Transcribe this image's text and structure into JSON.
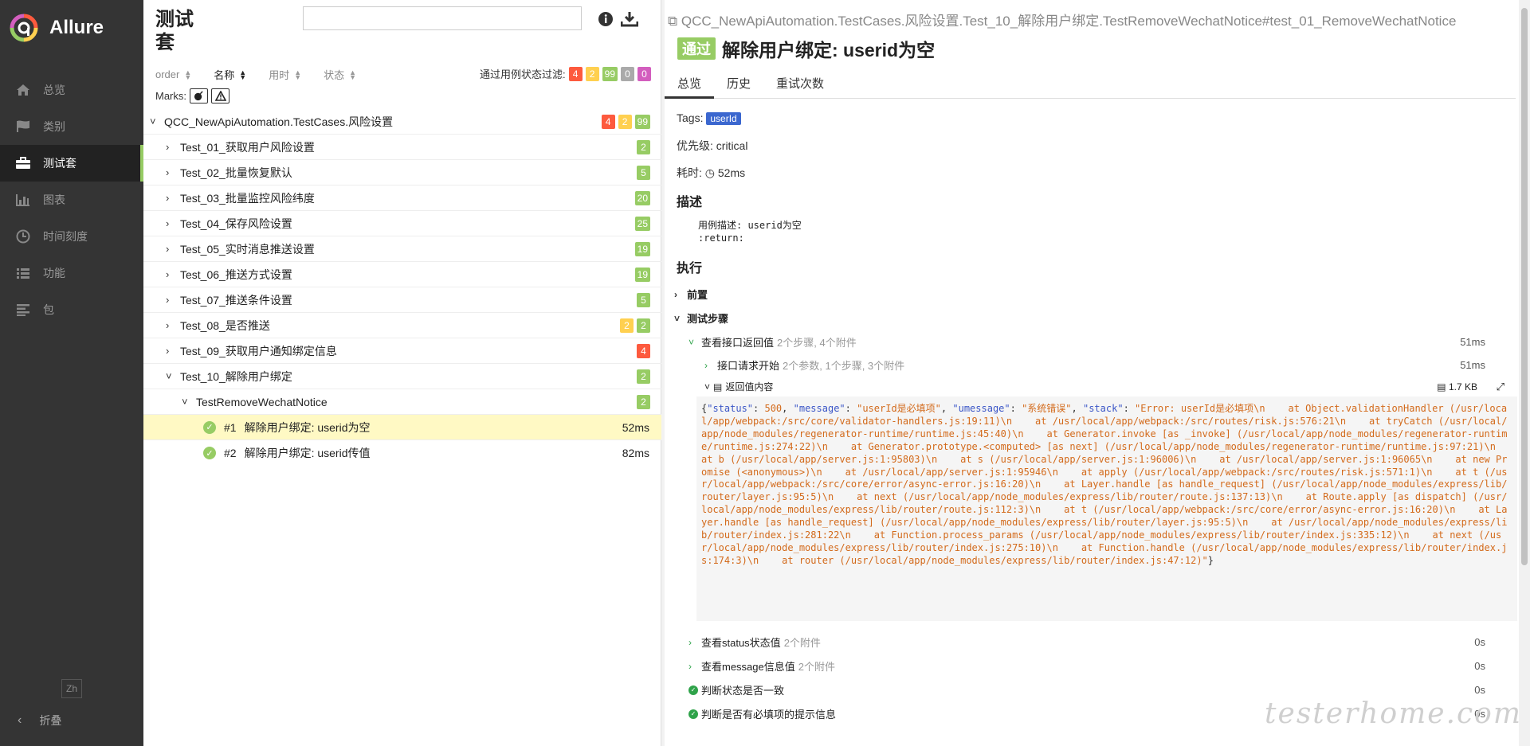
{
  "brand": {
    "name": "Allure"
  },
  "sidebar": {
    "items": [
      {
        "label": "总览",
        "icon": "home-icon"
      },
      {
        "label": "类别",
        "icon": "flag-icon"
      },
      {
        "label": "测试套",
        "icon": "briefcase-icon",
        "active": true
      },
      {
        "label": "图表",
        "icon": "bar-chart-icon"
      },
      {
        "label": "时间刻度",
        "icon": "clock-icon"
      },
      {
        "label": "功能",
        "icon": "list-icon"
      },
      {
        "label": "包",
        "icon": "align-left-icon"
      }
    ],
    "lang": "Zh",
    "collapse": "折叠"
  },
  "suites": {
    "title": "测试套",
    "search_placeholder": "",
    "sort": [
      "order",
      "名称",
      "用时",
      "状态"
    ],
    "filter_label": "通过用例状态过滤:",
    "filter_counts": {
      "failed": "4",
      "broken": "2",
      "passed": "99",
      "skipped": "0",
      "unknown": "0"
    },
    "marks_label": "Marks:",
    "root": {
      "name": "QCC_NewApiAutomation.TestCases.风险设置",
      "counts": [
        "4",
        "2",
        "99"
      ]
    },
    "groups": [
      {
        "name": "Test_01_获取用户风险设置",
        "counts": [
          {
            "v": "2",
            "c": "passed"
          }
        ]
      },
      {
        "name": "Test_02_批量恢复默认",
        "counts": [
          {
            "v": "5",
            "c": "passed"
          }
        ]
      },
      {
        "name": "Test_03_批量监控风险纬度",
        "counts": [
          {
            "v": "20",
            "c": "passed"
          }
        ]
      },
      {
        "name": "Test_04_保存风险设置",
        "counts": [
          {
            "v": "25",
            "c": "passed"
          }
        ]
      },
      {
        "name": "Test_05_实时消息推送设置",
        "counts": [
          {
            "v": "19",
            "c": "passed"
          }
        ]
      },
      {
        "name": "Test_06_推送方式设置",
        "counts": [
          {
            "v": "19",
            "c": "passed"
          }
        ]
      },
      {
        "name": "Test_07_推送条件设置",
        "counts": [
          {
            "v": "5",
            "c": "passed"
          }
        ]
      },
      {
        "name": "Test_08_是否推送",
        "counts": [
          {
            "v": "2",
            "c": "broken"
          },
          {
            "v": "2",
            "c": "passed"
          }
        ]
      },
      {
        "name": "Test_09_获取用户通知绑定信息",
        "counts": [
          {
            "v": "4",
            "c": "failed"
          }
        ]
      },
      {
        "name": "Test_10_解除用户绑定",
        "counts": [
          {
            "v": "2",
            "c": "passed"
          }
        ]
      }
    ],
    "class": {
      "name": "TestRemoveWechatNotice",
      "count": "2"
    },
    "tests": [
      {
        "num": "#1",
        "name": "解除用户绑定: userid为空",
        "dur": "52ms"
      },
      {
        "num": "#2",
        "name": "解除用户绑定: userid传值",
        "dur": "82ms"
      }
    ]
  },
  "detail": {
    "breadcrumb": "QCC_NewApiAutomation.TestCases.风险设置.Test_10_解除用户绑定.TestRemoveWechatNotice#test_01_RemoveWechatNotice",
    "status": "通过",
    "title": "解除用户绑定: userid为空",
    "tabs": [
      "总览",
      "历史",
      "重试次数"
    ],
    "tags_label": "Tags:",
    "tag": "userId",
    "severity_label": "优先级:",
    "severity": "critical",
    "duration_label": "耗时:",
    "duration": "52ms",
    "desc_title": "描述",
    "desc_line1": "用例描述: userid为空",
    "desc_line2": ":return:",
    "exec_title": "执行",
    "setup": "前置",
    "steps_title": "测试步骤",
    "steps": [
      {
        "name": "查看接口返回值",
        "meta": "2个步骤, 4个附件",
        "dur": "51ms"
      },
      {
        "name": "接口请求开始",
        "meta": "2个参数, 1个步骤, 3个附件",
        "dur": "51ms"
      },
      {
        "name": "查看status状态值",
        "meta": "2个附件",
        "dur": "0s"
      },
      {
        "name": "查看message信息值",
        "meta": "2个附件",
        "dur": "0s"
      },
      {
        "name": "判断状态是否一致",
        "meta": "",
        "dur": "0s"
      },
      {
        "name": "判断是否有必填项的提示信息",
        "meta": "",
        "dur": "0s"
      }
    ],
    "attachment": {
      "name": "返回值内容",
      "size": "1.7 KB"
    },
    "code": {
      "k1": "\"status\"",
      "v1": "500",
      "k2": "\"message\"",
      "v2": "\"userId是必填项\"",
      "k3": "\"umessage\"",
      "v3": "\"系统错误\"",
      "k4": "\"stack\"",
      "v4": "\"Error: userId是必填项\\n    at Object.validationHandler (/usr/local/app/webpack:/src/core/validator-handlers.js:19:11)\\n    at /usr/local/app/webpack:/src/routes/risk.js:576:21\\n    at tryCatch (/usr/local/app/node_modules/regenerator-runtime/runtime.js:45:40)\\n    at Generator.invoke [as _invoke] (/usr/local/app/node_modules/regenerator-runtime/runtime.js:274:22)\\n    at Generator.prototype.<computed> [as next] (/usr/local/app/node_modules/regenerator-runtime/runtime.js:97:21)\\n    at b (/usr/local/app/server.js:1:95803)\\n    at s (/usr/local/app/server.js:1:96006)\\n    at /usr/local/app/server.js:1:96065\\n    at new Promise (<anonymous>)\\n    at /usr/local/app/server.js:1:95946\\n    at apply (/usr/local/app/webpack:/src/routes/risk.js:571:1)\\n    at t (/usr/local/app/webpack:/src/core/error/async-error.js:16:20)\\n    at Layer.handle [as handle_request] (/usr/local/app/node_modules/express/lib/router/layer.js:95:5)\\n    at next (/usr/local/app/node_modules/express/lib/router/route.js:137:13)\\n    at Route.apply [as dispatch] (/usr/local/app/node_modules/express/lib/router/route.js:112:3)\\n    at t (/usr/local/app/webpack:/src/core/error/async-error.js:16:20)\\n    at Layer.handle [as handle_request] (/usr/local/app/node_modules/express/lib/router/layer.js:95:5)\\n    at /usr/local/app/node_modules/express/lib/router/index.js:281:22\\n    at Function.process_params (/usr/local/app/node_modules/express/lib/router/index.js:335:12)\\n    at next (/usr/local/app/node_modules/express/lib/router/index.js:275:10)\\n    at Function.handle (/usr/local/app/node_modules/express/lib/router/index.js:174:3)\\n    at router (/usr/local/app/node_modules/express/lib/router/index.js:47:12)\""
    },
    "watermark": "testerhome.com"
  },
  "colors": {
    "passed": "#97cc64",
    "failed": "#fd5a3e",
    "broken": "#ffd050",
    "skipped": "#aaaaaa",
    "unknown": "#d35ebe",
    "tag": "#3b67cf"
  }
}
